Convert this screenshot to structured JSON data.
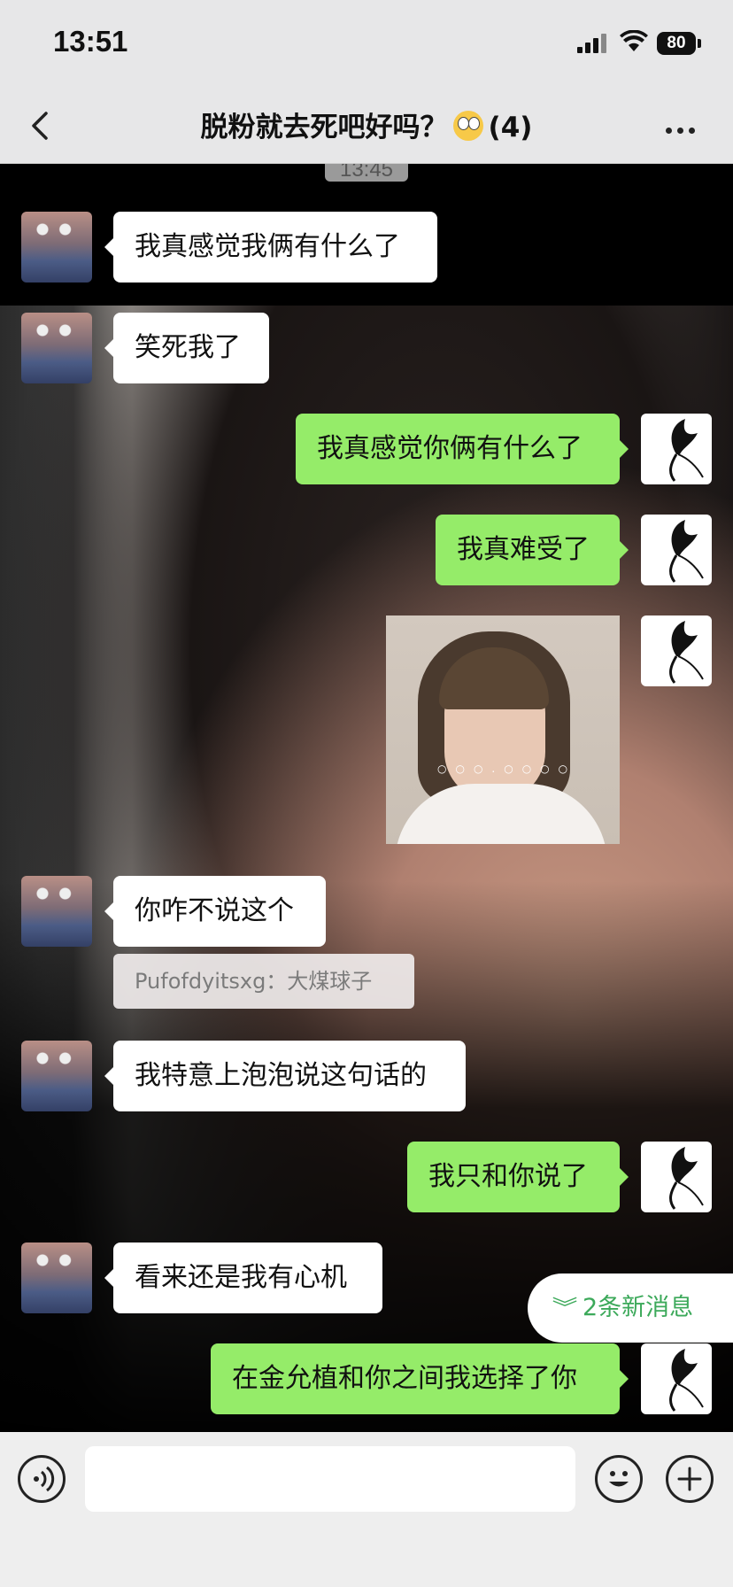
{
  "status_bar": {
    "time": "13:51",
    "battery": "80"
  },
  "nav": {
    "title": "脱粉就去死吧好吗？",
    "member_count": "(4)"
  },
  "chat": {
    "time_stamp": "13:45",
    "messages": [
      {
        "from": "other",
        "text": "我真感觉我俩有什么了"
      },
      {
        "from": "other",
        "text": "笑死我了"
      },
      {
        "from": "self",
        "text": "我真感觉你俩有什么了"
      },
      {
        "from": "self",
        "text": "我真难受了"
      },
      {
        "from": "self",
        "type": "image",
        "text": ""
      },
      {
        "from": "other",
        "text": "你咋不说这个"
      },
      {
        "from": "other",
        "text": "我特意上泡泡说这句话的"
      },
      {
        "from": "self",
        "text": "我只和你说了"
      },
      {
        "from": "other",
        "text": "看来还是我有心机"
      },
      {
        "from": "self",
        "text": "在金允植和你之间我选择了你"
      }
    ],
    "quote": "Pufofdyitsxg：大煤球子",
    "new_messages": "2条新消息"
  },
  "input": {
    "placeholder": ""
  },
  "icons": {
    "back": "chevron-left-icon",
    "more": "more-dots-icon",
    "voice": "voice-icon",
    "emoji": "emoji-icon",
    "plus": "plus-icon"
  },
  "colors": {
    "self_bubble": "#95ec69",
    "other_bubble": "#ffffff",
    "new_message_text": "#3ca95a"
  }
}
